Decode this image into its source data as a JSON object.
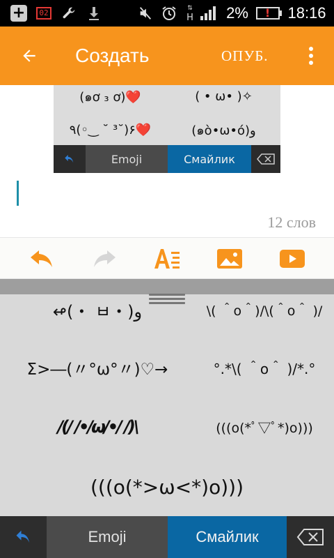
{
  "status_bar": {
    "sim_label": "02",
    "battery_percent": "2%",
    "time": "18:16",
    "network_label": "H",
    "icons": [
      "plus-icon",
      "sim-card-icon",
      "wrench-icon",
      "download-icon",
      "mute-icon",
      "alarm-icon",
      "signal-icon",
      "battery-low-icon"
    ]
  },
  "app_bar": {
    "title": "Создать",
    "publish_label": "ОПУБ.",
    "back_icon": "arrow-left-icon",
    "overflow_icon": "more-vert-icon",
    "background": "#f7941d"
  },
  "embedded_image": {
    "rows": [
      [
        "(๑ơ ₃ ơ)❤️",
        "( • ω• )✧"
      ],
      [
        "٩(◦‿ ˘ ³˘)۶❤️",
        "(๑ò•ω•ó)و"
      ]
    ],
    "tabs": {
      "emoji": "Emoji",
      "smiley": "Смайлик"
    }
  },
  "editor": {
    "word_count": "12 слов",
    "cursor_color": "#1e8fa8"
  },
  "toolbar": {
    "icons": [
      "undo-icon",
      "redo-icon",
      "font-format-icon",
      "image-icon",
      "video-icon"
    ],
    "accent": "#f7941d"
  },
  "keyboard": {
    "kaomoji": [
      "↫(・ ㅂ・)و",
      "\\( ＾o＾)/\\(＾o＾ )/",
      "Σ>―(〃°ω°〃)♡→",
      "°.*\\( ＾o＾ )/*.°",
      "/(/ /•/ω/•/ /)\\",
      "(((o(*ﾟ▽ﾟ*)o)))",
      "(((o(*>ω<*)o)))"
    ],
    "tabs": {
      "emoji": "Emoji",
      "smiley": "Смайлик"
    },
    "selected_tab": "Смайлик",
    "selected_color": "#0a67a3"
  }
}
